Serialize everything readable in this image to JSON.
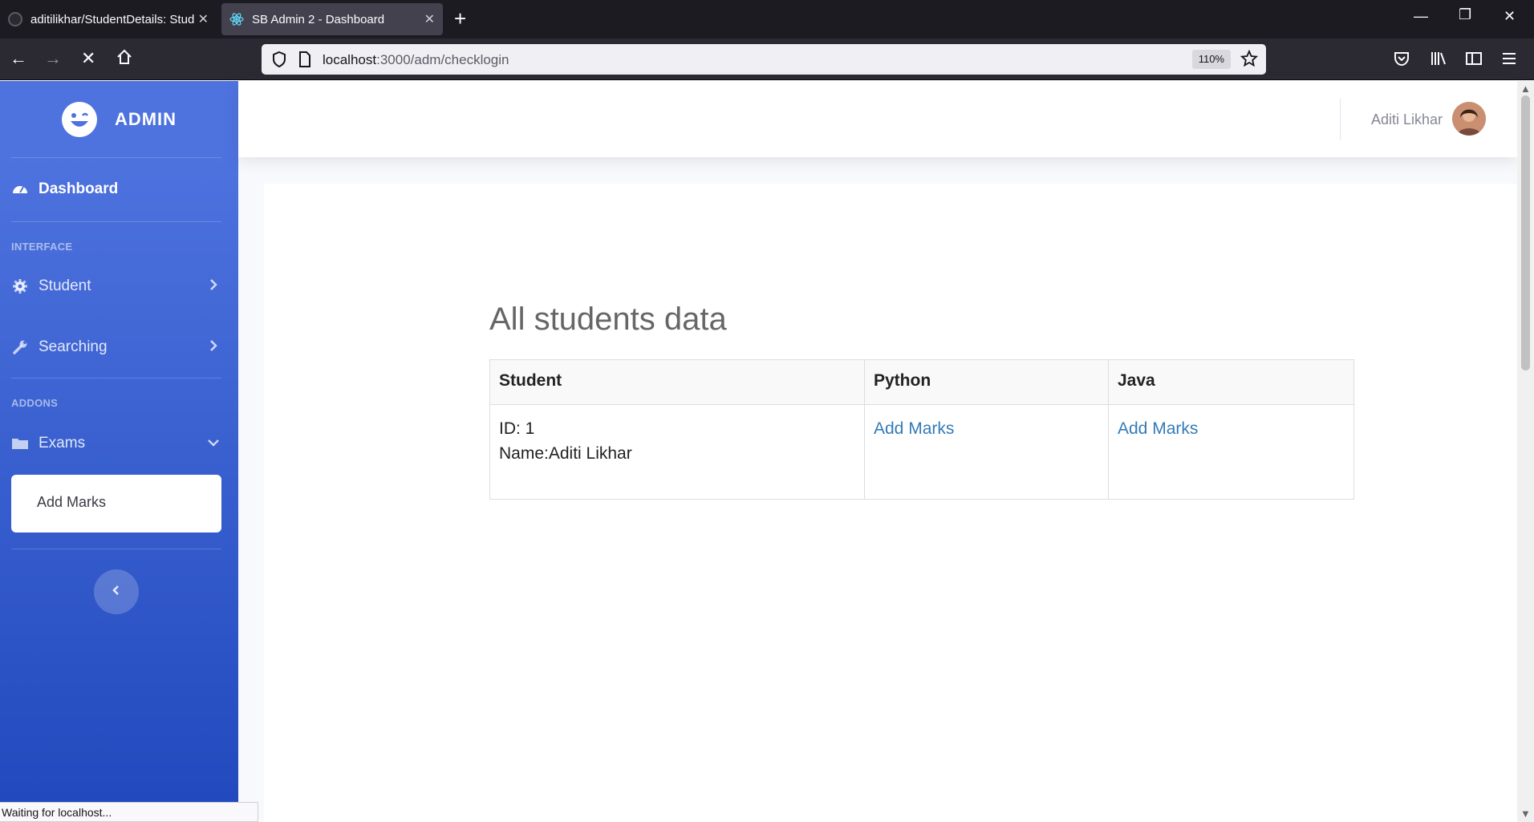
{
  "browser": {
    "tabs": [
      {
        "title": "aditilikhar/StudentDetails: Stud"
      },
      {
        "title": "SB Admin 2 - Dashboard"
      }
    ],
    "url_host": "localhost",
    "url_path": ":3000/adm/checklogin",
    "zoom": "110%",
    "status": "Waiting for localhost..."
  },
  "sidebar": {
    "brand": "ADMIN",
    "dashboard_label": "Dashboard",
    "heading_interface": "INTERFACE",
    "student_label": "Student",
    "searching_label": "Searching",
    "heading_addons": "ADDONS",
    "exams_label": "Exams",
    "exams_sub": [
      "Add Marks"
    ]
  },
  "topbar": {
    "user_name": "Aditi Likhar"
  },
  "main": {
    "title": "All students data",
    "table": {
      "headers": [
        "Student",
        "Python",
        "Java"
      ],
      "rows": [
        {
          "id_line": "ID: 1",
          "name_line": "Name:Aditi Likhar",
          "python": "Add Marks",
          "java": "Add Marks"
        }
      ]
    }
  },
  "colors": {
    "sidebar_start": "#4e73df",
    "sidebar_end": "#224abe",
    "link": "#337ab7"
  },
  "icons": [
    "tachometer-icon",
    "cog-icon",
    "wrench-icon",
    "folder-icon",
    "chevron-right-icon",
    "chevron-down-icon",
    "chevron-left-icon",
    "laugh-wink-icon"
  ]
}
